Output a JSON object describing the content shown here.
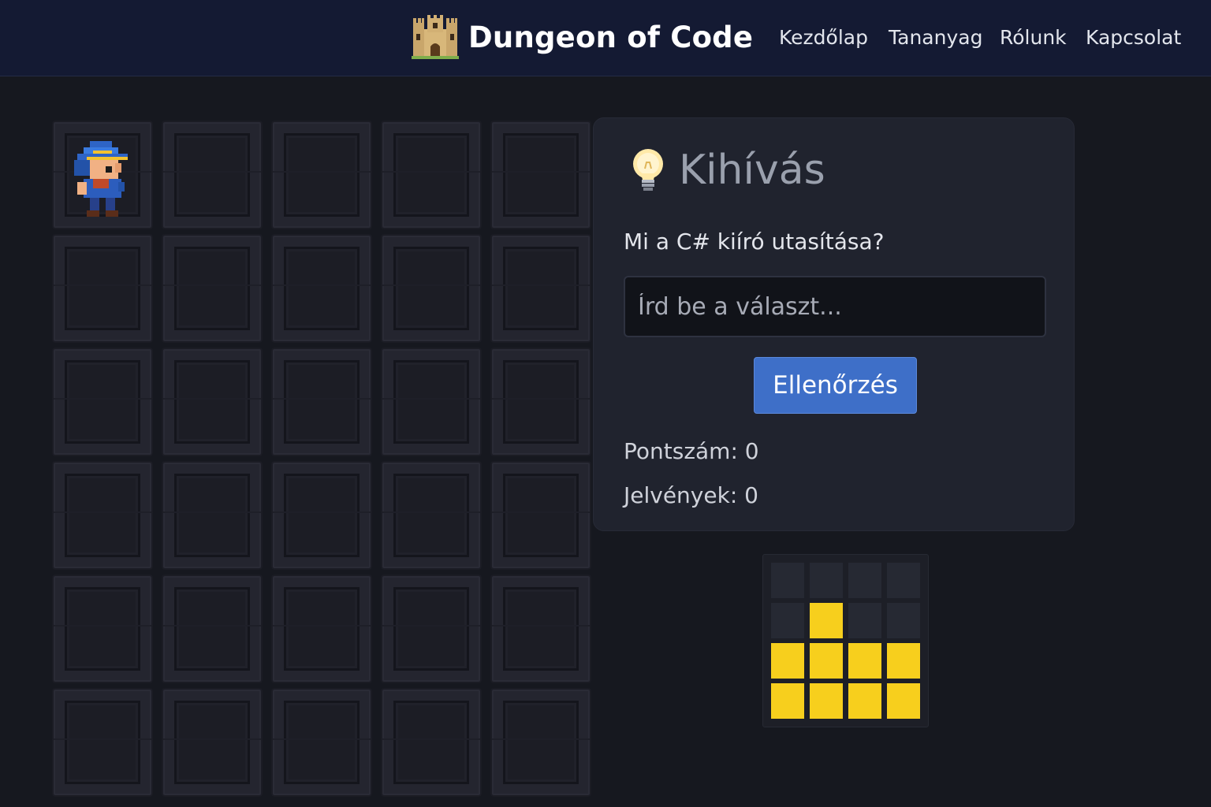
{
  "header": {
    "brand": "Dungeon of Code",
    "brand_icon": "castle-icon",
    "nav": [
      "Kezdőlap",
      "Tananyag",
      "Rólunk",
      "Kapcsolat"
    ]
  },
  "board": {
    "columns": 5,
    "rows": 6,
    "hero_position": {
      "row": 0,
      "col": 0
    },
    "hero_icon": "wizard-hero-sprite"
  },
  "challenge": {
    "icon": "lightbulb-icon",
    "title": "Kihívás",
    "question": "Mi a C# kiíró utasítása?",
    "answer_value": "",
    "answer_placeholder": "Írd be a választ...",
    "button_label": "Ellenőrzés",
    "score_text": "Pontszám: 0",
    "badges_text": "Jelvények: 0"
  },
  "minimap": {
    "columns": 4,
    "rows": 4,
    "cells": [
      [
        0,
        0,
        0,
        0
      ],
      [
        0,
        1,
        0,
        0
      ],
      [
        1,
        1,
        1,
        1
      ],
      [
        1,
        1,
        1,
        1
      ]
    ],
    "active_color": "#f7cf1d",
    "inactive_color": "#262933"
  },
  "colors": {
    "header_bg": "#141a33",
    "page_bg": "#16181f",
    "card_bg": "#20232e",
    "accent_button": "#3e6fc8"
  }
}
